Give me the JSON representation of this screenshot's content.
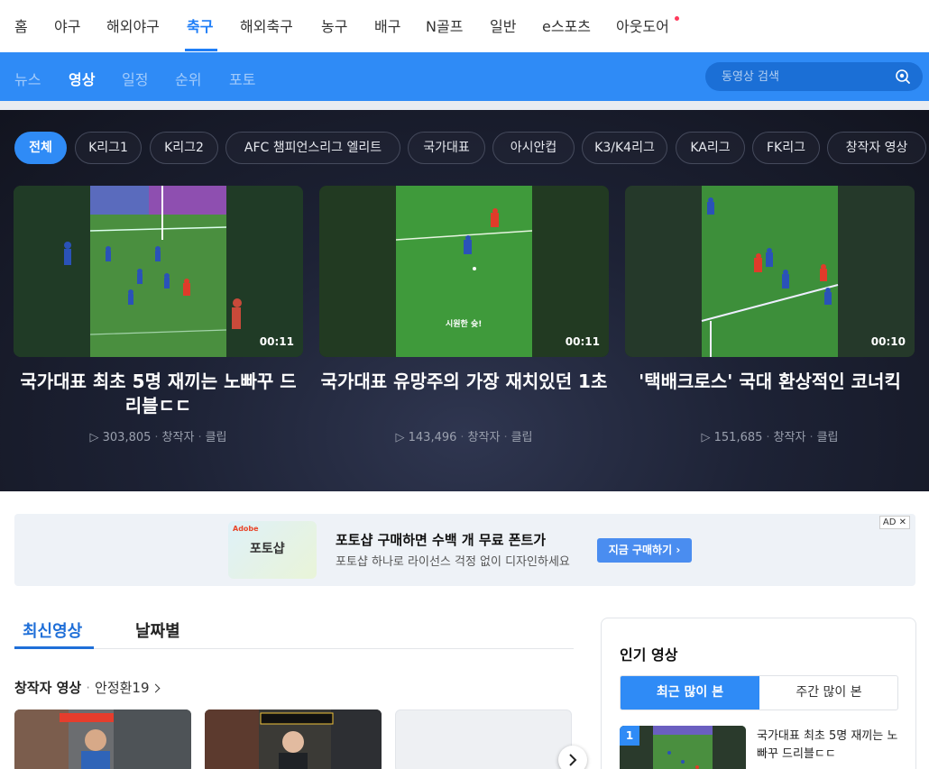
{
  "top_nav": {
    "items": [
      "홈",
      "야구",
      "해외야구",
      "축구",
      "해외축구",
      "농구",
      "배구",
      "N골프",
      "일반",
      "e스포츠",
      "아웃도어"
    ],
    "active": "축구"
  },
  "sub_nav": {
    "items": [
      "뉴스",
      "영상",
      "일정",
      "순위",
      "포토"
    ],
    "active": "영상"
  },
  "search": {
    "placeholder": "동영상 검색",
    "icon": "search-icon"
  },
  "chips": [
    "전체",
    "K리그1",
    "K리그2",
    "AFC 챔피언스리그 엘리트",
    "국가대표",
    "아시안컵",
    "K3/K4리그",
    "KA리그",
    "FK리그",
    "창작자 영상"
  ],
  "featured": [
    {
      "title": "국가대표 최초 5명 재끼는 노빠꾸 드리블ㄷㄷ",
      "duration": "00:11",
      "views": "303,805",
      "source": "창작자",
      "type": "클립"
    },
    {
      "title": "국가대표 유망주의 가장 재치있던 1초",
      "duration": "00:11",
      "views": "143,496",
      "source": "창작자",
      "type": "클립",
      "caption": "시원한 슛!"
    },
    {
      "title": "'택배크로스' 국대 환상적인 코너킥",
      "duration": "00:10",
      "views": "151,685",
      "source": "창작자",
      "type": "클립"
    }
  ],
  "ad": {
    "brand": "Adobe",
    "thumb_text": "포토샵",
    "title": "포토샵 구매하면 수백 개 무료 폰트가",
    "desc": "포토샵 하나로 라이선스 걱정 없이 디자인하세요",
    "cta": "지금 구매하기 ›",
    "badge": "AD ✕"
  },
  "tabs": {
    "items": [
      "최신영상",
      "날짜별"
    ],
    "active": "최신영상"
  },
  "section": {
    "heading": "창작자 영상",
    "link": "안정환19"
  },
  "popular": {
    "title": "인기 영상",
    "segments": [
      "최근 많이 본",
      "주간 많이 본"
    ],
    "first_item": {
      "rank": "1",
      "title": "국가대표 최초 5명 재끼는 노빠꾸 드리블ㄷㄷ"
    }
  },
  "colors": {
    "accent": "#2f8bf6",
    "dark_bg": "#1d2235",
    "new_dot": "#ff3a5c"
  }
}
